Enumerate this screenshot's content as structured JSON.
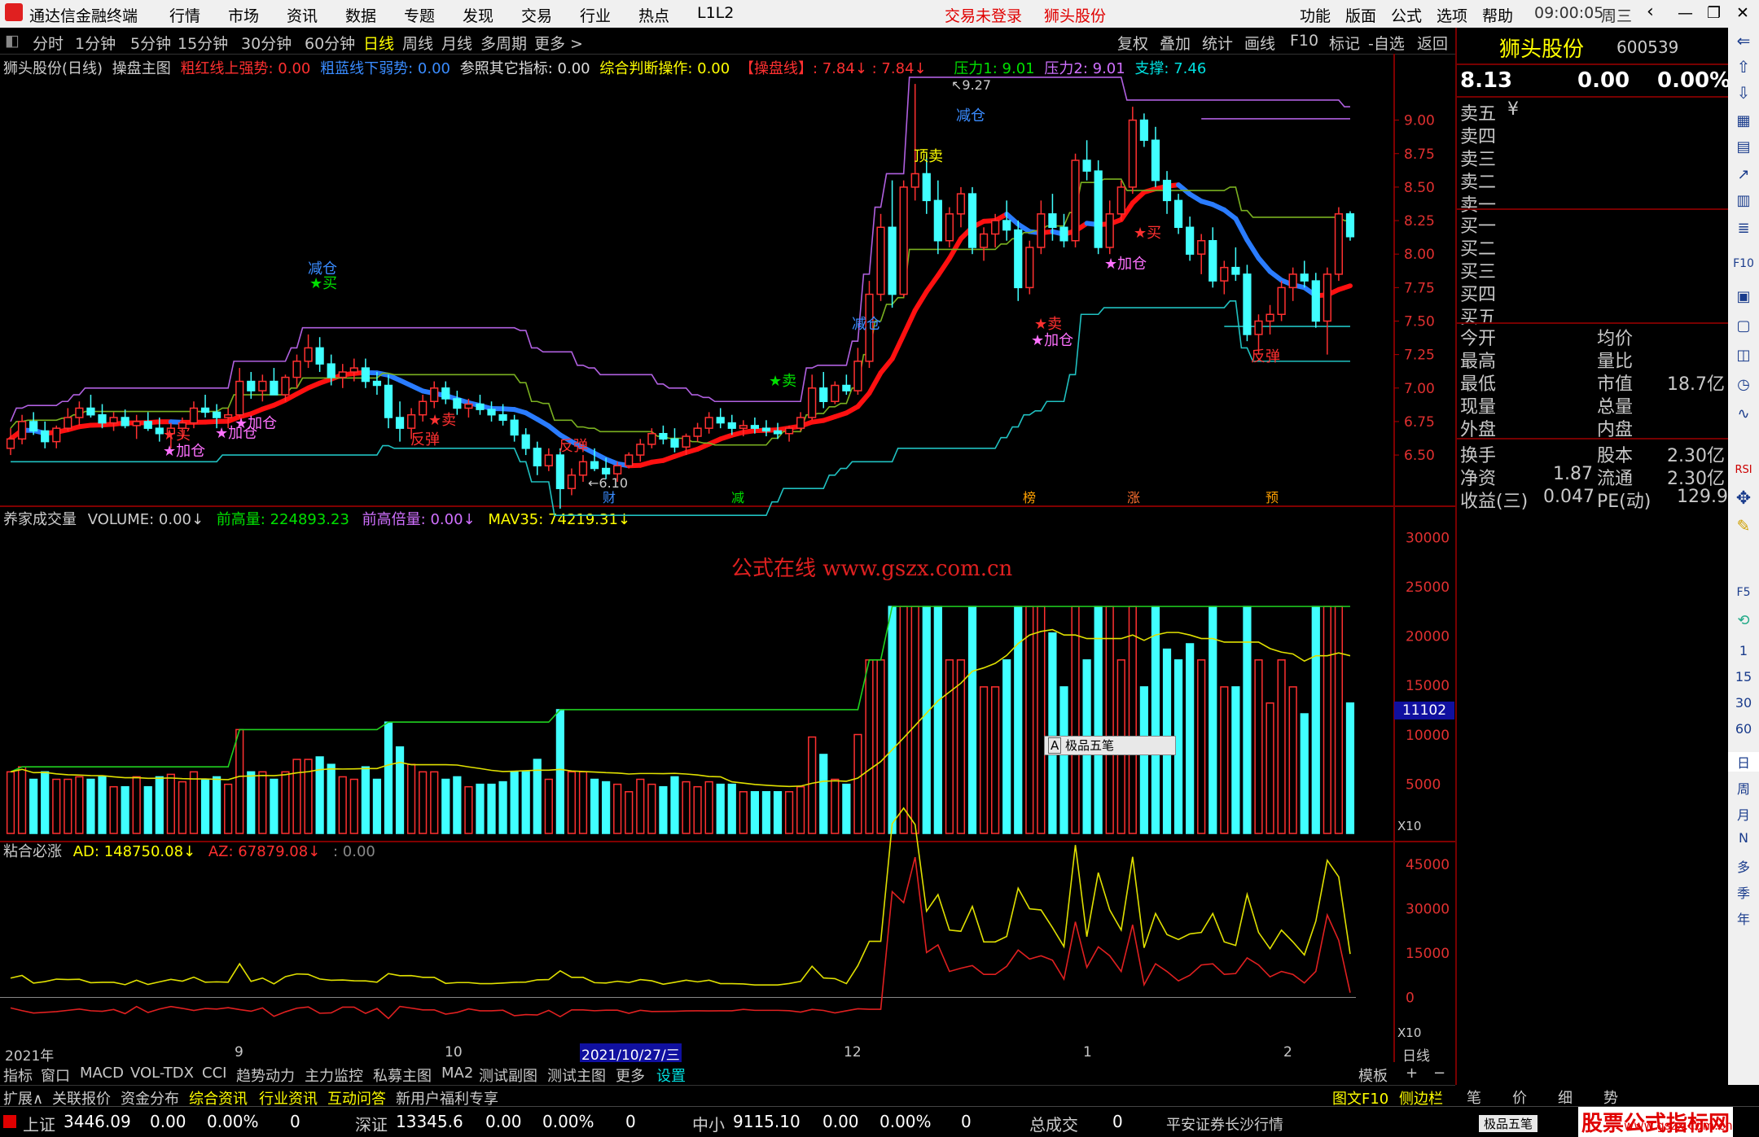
{
  "menubar": {
    "app_title": "通达信金融终端",
    "menu_items": [
      "行情",
      "市场",
      "资讯",
      "数据",
      "专题",
      "发现",
      "交易",
      "行业",
      "热点",
      "L1L2"
    ],
    "trade_status": "交易未登录",
    "stock_name": "狮头股份",
    "right_items": [
      "功能",
      "版面",
      "公式",
      "选项",
      "帮助"
    ],
    "time": "09:00:05",
    "weekday": "周三"
  },
  "periods": {
    "items": [
      "分时",
      "1分钟",
      "5分钟",
      "15分钟",
      "30分钟",
      "60分钟",
      "日线",
      "周线",
      "月线",
      "多周期",
      "更多 >"
    ],
    "selected": "日线",
    "tools": [
      "复权",
      "叠加",
      "统计",
      "画线",
      "F10",
      "标记",
      "-自选",
      "返回"
    ]
  },
  "main_panel": {
    "title": "狮头股份(日线)",
    "indicator": "操盘主图",
    "red_line": "粗红线上强势: 0.00",
    "blue_line": "粗蓝线下弱势: 0.00",
    "ref": "参照其它指标: 0.00",
    "judge": "综合判断操作: 0.00",
    "line_label": "【操盘线】: 7.84↓ : 7.84↓",
    "pressure1": "压力1: 9.01",
    "pressure2": "压力2: 9.01",
    "support": "支撑: 7.46",
    "y_ticks": [
      "9.00",
      "8.75",
      "8.50",
      "8.25",
      "8.00",
      "7.75",
      "7.50",
      "7.25",
      "7.00",
      "6.75",
      "6.50"
    ],
    "markers": [
      "财",
      "减",
      "榜",
      "涨",
      "预"
    ]
  },
  "annotations": {
    "high_price": "9.27",
    "low_price": "6.10",
    "reduce": "减仓",
    "top_sell": "顶卖",
    "buy": "★买",
    "sell": "★卖",
    "add": "★加仓",
    "rebound": "反弹"
  },
  "volume_panel": {
    "title": "养家成交量",
    "volume": "VOLUME: 0.00↓",
    "prev_high": "前高量: 224893.23",
    "prev_high_mult": "前高倍量: 0.00↓",
    "mav": "MAV35: 74219.31↓",
    "y_ticks": [
      "30000",
      "25000",
      "20000",
      "15000",
      "10000",
      "5000"
    ],
    "current_tag": "11102",
    "unit": "X10",
    "watermark": "公式在线  www.gszx.com.cn",
    "toolbar": "极品五笔"
  },
  "ad_panel": {
    "title": "粘合必涨",
    "ad": "AD: 148750.08↓",
    "az": "AZ: 67879.08↓",
    "extra": ": 0.00",
    "y_ticks": [
      "45000",
      "30000",
      "15000",
      "0"
    ],
    "unit": "X10"
  },
  "x_axis": {
    "labels": [
      "2021年",
      "9",
      "10",
      "2021/10/27/三",
      "12",
      "1",
      "2"
    ],
    "period": "日线"
  },
  "quote_panel": {
    "name": "狮头股份",
    "code": "600539",
    "price": "8.13",
    "change": "0.00",
    "pct": "0.00%",
    "sell_levels": [
      "卖五",
      "卖四",
      "卖三",
      "卖二",
      "卖一"
    ],
    "buy_levels": [
      "买一",
      "买二",
      "买三",
      "买四",
      "买五"
    ],
    "yen": "¥",
    "rows_left": [
      "今开",
      "最高",
      "最低",
      "现量",
      "外盘"
    ],
    "rows_right": [
      "均价",
      "量比",
      "市值",
      "总量",
      "内盘"
    ],
    "market_value": "18.7亿",
    "rows2": [
      {
        "l": "换手",
        "lv": "",
        "r": "股本",
        "rv": "2.30亿"
      },
      {
        "l": "净资",
        "lv": "1.87",
        "r": "流通",
        "rv": "2.30亿"
      },
      {
        "l": "收益(三)",
        "lv": "0.047",
        "r": "PE(动)",
        "rv": "129.9"
      }
    ]
  },
  "tabs_row1": [
    "指标",
    "窗口",
    "MACD",
    "VOL-TDX",
    "CCI",
    "趋势动力",
    "主力监控",
    "私募主图",
    "MA2",
    "测试副图",
    "测试主图",
    "更多",
    "设置"
  ],
  "tabs_row1_right": [
    "模板",
    "+",
    "−"
  ],
  "tabs_row2": [
    "扩展∧",
    "关联报价",
    "资金分布",
    "综合资讯",
    "行业资讯",
    "互动问答",
    "新用户福利专享"
  ],
  "tabs_row2_right": [
    "图文F10",
    "侧边栏《",
    "笔",
    "价",
    "细",
    "势"
  ],
  "statusbar": {
    "items": [
      {
        "name": "上证",
        "value": "3446.09",
        "chg": "0.00",
        "pct": "0.00%",
        "vol": "0"
      },
      {
        "name": "深证",
        "value": "13345.6",
        "chg": "0.00",
        "pct": "0.00%",
        "vol": "0"
      },
      {
        "name": "中小",
        "value": "9115.10",
        "chg": "0.00",
        "pct": "0.00%",
        "vol": "0"
      }
    ],
    "total_label": "总成交",
    "total_value": "0",
    "broker": "平安证券长沙行情",
    "ime": "极品五笔",
    "brand": "股票公式指标网",
    "brand_url": "www.gszx.com.cn"
  },
  "sidebar": {
    "numbers": [
      "1",
      "15",
      "30",
      "60"
    ],
    "periods": [
      "日",
      "周",
      "月",
      "N",
      "多",
      "季",
      "年"
    ],
    "labels": [
      "F10",
      "RSI",
      "F5"
    ]
  },
  "chart_data": {
    "type": "candlestick",
    "title": "狮头股份(日线)",
    "ylim": [
      6.3,
      9.35
    ],
    "candles": [
      [
        6.55,
        6.7,
        6.5,
        6.62
      ],
      [
        6.62,
        6.8,
        6.58,
        6.75
      ],
      [
        6.75,
        6.82,
        6.65,
        6.68
      ],
      [
        6.68,
        6.75,
        6.55,
        6.6
      ],
      [
        6.6,
        6.72,
        6.55,
        6.7
      ],
      [
        6.7,
        6.85,
        6.68,
        6.78
      ],
      [
        6.78,
        6.9,
        6.72,
        6.85
      ],
      [
        6.85,
        6.95,
        6.78,
        6.8
      ],
      [
        6.8,
        6.88,
        6.7,
        6.74
      ],
      [
        6.74,
        6.82,
        6.68,
        6.78
      ],
      [
        6.78,
        6.84,
        6.7,
        6.72
      ],
      [
        6.72,
        6.8,
        6.62,
        6.75
      ],
      [
        6.75,
        6.82,
        6.68,
        6.7
      ],
      [
        6.7,
        6.78,
        6.6,
        6.66
      ],
      [
        6.66,
        6.74,
        6.55,
        6.7
      ],
      [
        6.7,
        6.78,
        6.62,
        6.74
      ],
      [
        6.74,
        6.9,
        6.7,
        6.85
      ],
      [
        6.85,
        6.95,
        6.78,
        6.82
      ],
      [
        6.82,
        6.88,
        6.7,
        6.78
      ],
      [
        6.78,
        6.85,
        6.7,
        6.8
      ],
      [
        6.8,
        7.15,
        6.78,
        7.05
      ],
      [
        7.05,
        7.12,
        6.92,
        6.98
      ],
      [
        6.98,
        7.1,
        6.9,
        7.05
      ],
      [
        7.05,
        7.15,
        6.98,
        6.95
      ],
      [
        6.95,
        7.1,
        6.9,
        7.08
      ],
      [
        7.08,
        7.25,
        7.0,
        7.2
      ],
      [
        7.2,
        7.4,
        7.15,
        7.3
      ],
      [
        7.3,
        7.38,
        7.12,
        7.18
      ],
      [
        7.18,
        7.25,
        7.02,
        7.08
      ],
      [
        7.08,
        7.18,
        7.0,
        7.12
      ],
      [
        7.12,
        7.22,
        7.05,
        7.15
      ],
      [
        7.15,
        7.22,
        7.0,
        7.05
      ],
      [
        7.05,
        7.12,
        6.95,
        7.02
      ],
      [
        7.02,
        7.1,
        6.7,
        6.78
      ],
      [
        6.78,
        6.9,
        6.6,
        6.7
      ],
      [
        6.7,
        6.85,
        6.62,
        6.8
      ],
      [
        6.8,
        6.95,
        6.75,
        6.9
      ],
      [
        6.9,
        7.05,
        6.85,
        7.0
      ],
      [
        7.0,
        7.05,
        6.88,
        6.92
      ],
      [
        6.92,
        6.98,
        6.8,
        6.85
      ],
      [
        6.85,
        6.92,
        6.78,
        6.88
      ],
      [
        6.88,
        6.95,
        6.8,
        6.84
      ],
      [
        6.84,
        6.9,
        6.75,
        6.8
      ],
      [
        6.8,
        6.88,
        6.72,
        6.76
      ],
      [
        6.76,
        6.8,
        6.6,
        6.65
      ],
      [
        6.65,
        6.7,
        6.5,
        6.55
      ],
      [
        6.55,
        6.6,
        6.35,
        6.42
      ],
      [
        6.42,
        6.55,
        6.38,
        6.5
      ],
      [
        6.5,
        6.55,
        6.1,
        6.25
      ],
      [
        6.25,
        6.4,
        6.2,
        6.35
      ],
      [
        6.35,
        6.5,
        6.3,
        6.45
      ],
      [
        6.45,
        6.55,
        6.38,
        6.4
      ],
      [
        6.4,
        6.48,
        6.32,
        6.36
      ],
      [
        6.36,
        6.45,
        6.3,
        6.42
      ],
      [
        6.42,
        6.52,
        6.4,
        6.5
      ],
      [
        6.5,
        6.62,
        6.45,
        6.58
      ],
      [
        6.58,
        6.7,
        6.55,
        6.66
      ],
      [
        6.66,
        6.72,
        6.58,
        6.62
      ],
      [
        6.62,
        6.7,
        6.52,
        6.56
      ],
      [
        6.56,
        6.66,
        6.5,
        6.64
      ],
      [
        6.64,
        6.74,
        6.6,
        6.7
      ],
      [
        6.7,
        6.82,
        6.66,
        6.78
      ],
      [
        6.78,
        6.85,
        6.7,
        6.74
      ],
      [
        6.74,
        6.8,
        6.65,
        6.7
      ],
      [
        6.7,
        6.76,
        6.64,
        6.72
      ],
      [
        6.72,
        6.78,
        6.66,
        6.7
      ],
      [
        6.7,
        6.76,
        6.64,
        6.68
      ],
      [
        6.68,
        6.74,
        6.62,
        6.66
      ],
      [
        6.66,
        6.72,
        6.6,
        6.7
      ],
      [
        6.7,
        6.82,
        6.68,
        6.78
      ],
      [
        6.78,
        7.1,
        6.76,
        7.0
      ],
      [
        7.0,
        7.12,
        6.85,
        6.9
      ],
      [
        6.9,
        7.05,
        6.88,
        7.02
      ],
      [
        7.02,
        7.1,
        6.95,
        6.98
      ],
      [
        6.98,
        7.3,
        6.95,
        7.2
      ],
      [
        7.2,
        7.8,
        7.15,
        7.7
      ],
      [
        7.7,
        8.3,
        7.65,
        8.2
      ],
      [
        8.2,
        8.55,
        7.6,
        7.7
      ],
      [
        7.7,
        8.55,
        7.68,
        8.5
      ],
      [
        8.5,
        9.27,
        8.4,
        8.6
      ],
      [
        8.6,
        8.75,
        8.3,
        8.4
      ],
      [
        8.4,
        8.55,
        8.0,
        8.1
      ],
      [
        8.1,
        8.35,
        8.05,
        8.3
      ],
      [
        8.3,
        8.5,
        8.2,
        8.45
      ],
      [
        8.45,
        8.5,
        8.0,
        8.05
      ],
      [
        8.05,
        8.2,
        7.95,
        8.15
      ],
      [
        8.15,
        8.3,
        8.05,
        8.25
      ],
      [
        8.25,
        8.4,
        8.1,
        8.18
      ],
      [
        8.18,
        8.25,
        7.65,
        7.75
      ],
      [
        7.75,
        8.1,
        7.7,
        8.05
      ],
      [
        8.05,
        8.4,
        8.0,
        8.3
      ],
      [
        8.3,
        8.45,
        8.1,
        8.2
      ],
      [
        8.2,
        8.3,
        8.05,
        8.1
      ],
      [
        8.1,
        8.75,
        8.05,
        8.7
      ],
      [
        8.7,
        8.85,
        8.55,
        8.62
      ],
      [
        8.62,
        8.7,
        8.0,
        8.05
      ],
      [
        8.05,
        8.4,
        8.0,
        8.3
      ],
      [
        8.3,
        8.55,
        8.25,
        8.5
      ],
      [
        8.5,
        9.1,
        8.45,
        9.0
      ],
      [
        9.0,
        9.05,
        8.8,
        8.85
      ],
      [
        8.85,
        8.95,
        8.5,
        8.55
      ],
      [
        8.55,
        8.62,
        8.3,
        8.4
      ],
      [
        8.4,
        8.45,
        8.15,
        8.2
      ],
      [
        8.2,
        8.28,
        7.95,
        8.0
      ],
      [
        8.0,
        8.15,
        7.85,
        8.1
      ],
      [
        8.1,
        8.2,
        7.75,
        7.8
      ],
      [
        7.8,
        7.95,
        7.7,
        7.9
      ],
      [
        7.9,
        8.05,
        7.8,
        7.85
      ],
      [
        7.85,
        7.92,
        7.35,
        7.4
      ],
      [
        7.4,
        7.55,
        7.25,
        7.5
      ],
      [
        7.5,
        7.62,
        7.4,
        7.55
      ],
      [
        7.55,
        7.8,
        7.5,
        7.75
      ],
      [
        7.75,
        7.9,
        7.65,
        7.85
      ],
      [
        7.85,
        7.95,
        7.75,
        7.8
      ],
      [
        7.8,
        7.86,
        7.45,
        7.5
      ],
      [
        7.5,
        7.9,
        7.25,
        7.85
      ],
      [
        7.85,
        8.35,
        7.8,
        8.3
      ],
      [
        8.3,
        8.32,
        8.1,
        8.13
      ]
    ]
  }
}
